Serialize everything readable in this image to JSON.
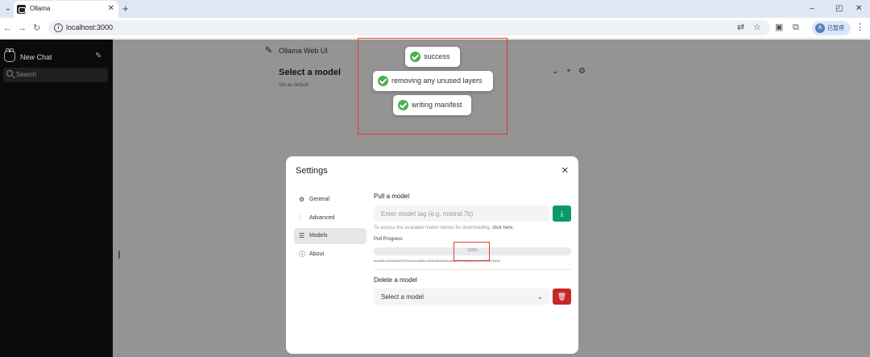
{
  "browser": {
    "tab_title": "Ollama",
    "tab_close": "✕",
    "new_tab": "+",
    "url": "localhost:3000",
    "profile_label": "已暂停",
    "profile_initial": "A",
    "controls": {
      "minimize": "–",
      "restore": "◰",
      "close": "✕"
    }
  },
  "sidebar": {
    "new_chat": "New Chat",
    "search_placeholder": "Search"
  },
  "header": {
    "title": "Ollama Web UI",
    "model_heading": "Select a model",
    "set_default": "Set as default"
  },
  "toasts": [
    {
      "text": "success"
    },
    {
      "text": "removing any unused layers"
    },
    {
      "text": "writing manifest"
    }
  ],
  "settings": {
    "title": "Settings",
    "nav": [
      {
        "label": "General",
        "icon": "gear-icon"
      },
      {
        "label": "Advanced",
        "icon": "sliders-icon"
      },
      {
        "label": "Models",
        "icon": "database-icon"
      },
      {
        "label": "About",
        "icon": "info-icon"
      }
    ],
    "active_nav": "Models",
    "pull": {
      "heading": "Pull a model",
      "placeholder": "Enter model tag (e.g. mistral:7b)",
      "hint": "To access the available model names for downloading,",
      "hint_link": "click here.",
      "progress_label": "Pull Progress",
      "progress_percent": "100%",
      "progress_value": 1.0,
      "digest": "sha256:ca0e0c8a02923c9e1b0db8213b5b40f3b6d2ad9a8e7601d80ac1e4df7f65e22d3d"
    },
    "delete": {
      "heading": "Delete a model",
      "selected": "Select a model"
    }
  },
  "colors": {
    "download_button": "#0a9a6a",
    "delete_button": "#c62828",
    "toast_check": "#4caf50",
    "highlight_box": "#e53935"
  }
}
